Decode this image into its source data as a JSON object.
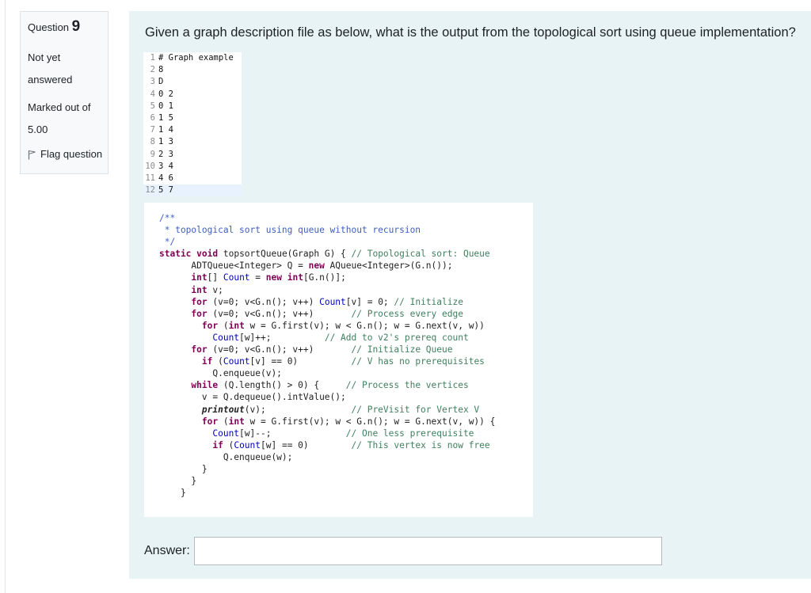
{
  "info": {
    "question_word": "Question",
    "question_number": "9",
    "state": "Not yet answered",
    "grade": "Marked out of 5.00",
    "flag_label": "Flag question"
  },
  "question": {
    "text": "Given a graph description file as below, what is the output from the topological sort using queue implementation?"
  },
  "graph_file": {
    "lines": [
      {
        "n": "1",
        "t": "# Graph example"
      },
      {
        "n": "2",
        "t": "8"
      },
      {
        "n": "3",
        "t": "D"
      },
      {
        "n": "4",
        "t": "0 2"
      },
      {
        "n": "5",
        "t": "0 1"
      },
      {
        "n": "6",
        "t": "1 5"
      },
      {
        "n": "7",
        "t": "1 4"
      },
      {
        "n": "8",
        "t": "1 3"
      },
      {
        "n": "9",
        "t": "2 3"
      },
      {
        "n": "10",
        "t": "3 4"
      },
      {
        "n": "11",
        "t": "4 6"
      },
      {
        "n": "12",
        "t": "5 7"
      }
    ]
  },
  "code": {
    "javadoc_open": "/**",
    "javadoc_text": " * topological sort using queue without recursion",
    "javadoc_close": " */",
    "c_toposort": "// Topological sort: Queue",
    "c_initialize": "// Initialize",
    "c_process_edge": "// Process every edge",
    "c_add_prereq": "// Add to v2's prereq count",
    "c_init_queue": "// Initialize Queue",
    "c_no_prereq": "// V has no prerequisites",
    "c_process_vertices": "// Process the vertices",
    "c_previsit": "// PreVisit for Vertex V",
    "c_one_less": "// One less prerequisite",
    "c_now_free": "// This vertex is now free"
  },
  "answer": {
    "label": "Answer:",
    "value": ""
  },
  "icons": {
    "flag": "flag-icon"
  }
}
